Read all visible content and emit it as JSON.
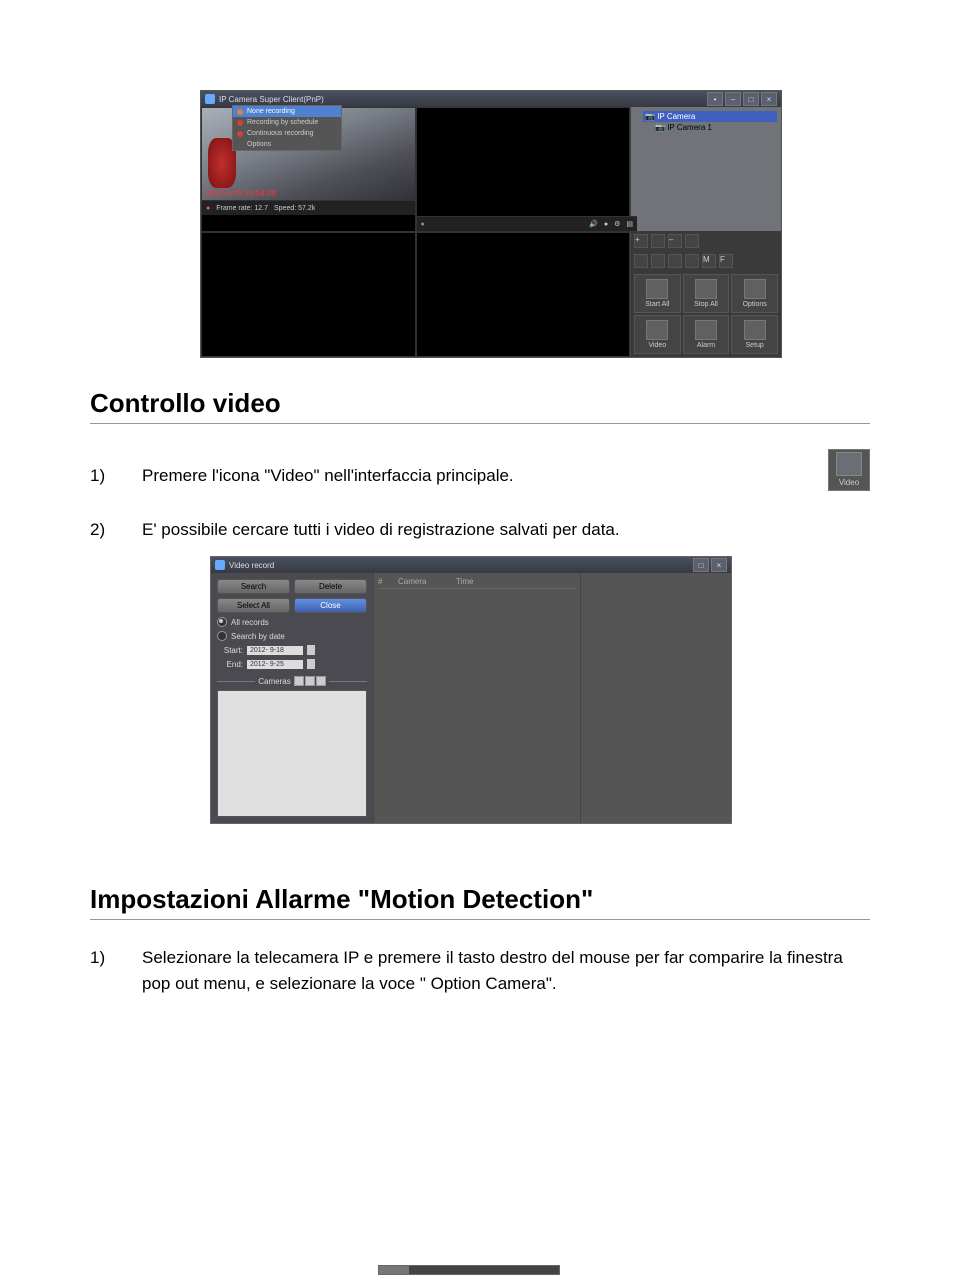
{
  "app1": {
    "title": "IP Camera Super Client(PnP)",
    "timestamp": "2012-9-25 10:54:09",
    "frame_rate_label": "Frame rate: 12.7",
    "speed_label": "Speed: 57.2k",
    "context_menu": {
      "none_recording": "None recording",
      "recording_by_schedule": "Recording by schedule",
      "continuous_recording": "Continuous recording",
      "options": "Options"
    },
    "tree": {
      "root": "IP Camera",
      "item1": "IP Camera 1"
    },
    "actions": {
      "start_all": "Start All",
      "stop_all": "Stop All",
      "options": "Options",
      "video": "Video",
      "alarm": "Alarm",
      "setup": "Setup"
    }
  },
  "section1": {
    "heading": "Controllo video",
    "step1_num": "1)",
    "step1_text": "Premere l'icona \"Video\" nell'interfaccia principale.",
    "step2_num": "2)",
    "step2_text": "E' possibile cercare tutti i video di registrazione salvati per data.",
    "video_icon_label": "Video"
  },
  "app2": {
    "title": "Video record",
    "search": "Search",
    "delete": "Delete",
    "select_all": "Select All",
    "close": "Close",
    "all_records": "All records",
    "search_by_date": "Search by date",
    "start_label": "Start:",
    "start_value": "2012- 9-18",
    "end_label": "End:",
    "end_value": "2012- 9-25",
    "cameras_label": "Cameras",
    "col_num": "#",
    "col_camera": "Camera",
    "col_time": "Time"
  },
  "section2": {
    "heading": "Impostazioni Allarme \"Motion Detection\"",
    "step1_num": "1)",
    "step1_text": "Selezionare la telecamera IP e premere il tasto destro del mouse per far comparire la finestra pop out menu, e selezionare la voce \" Option Camera\"."
  }
}
